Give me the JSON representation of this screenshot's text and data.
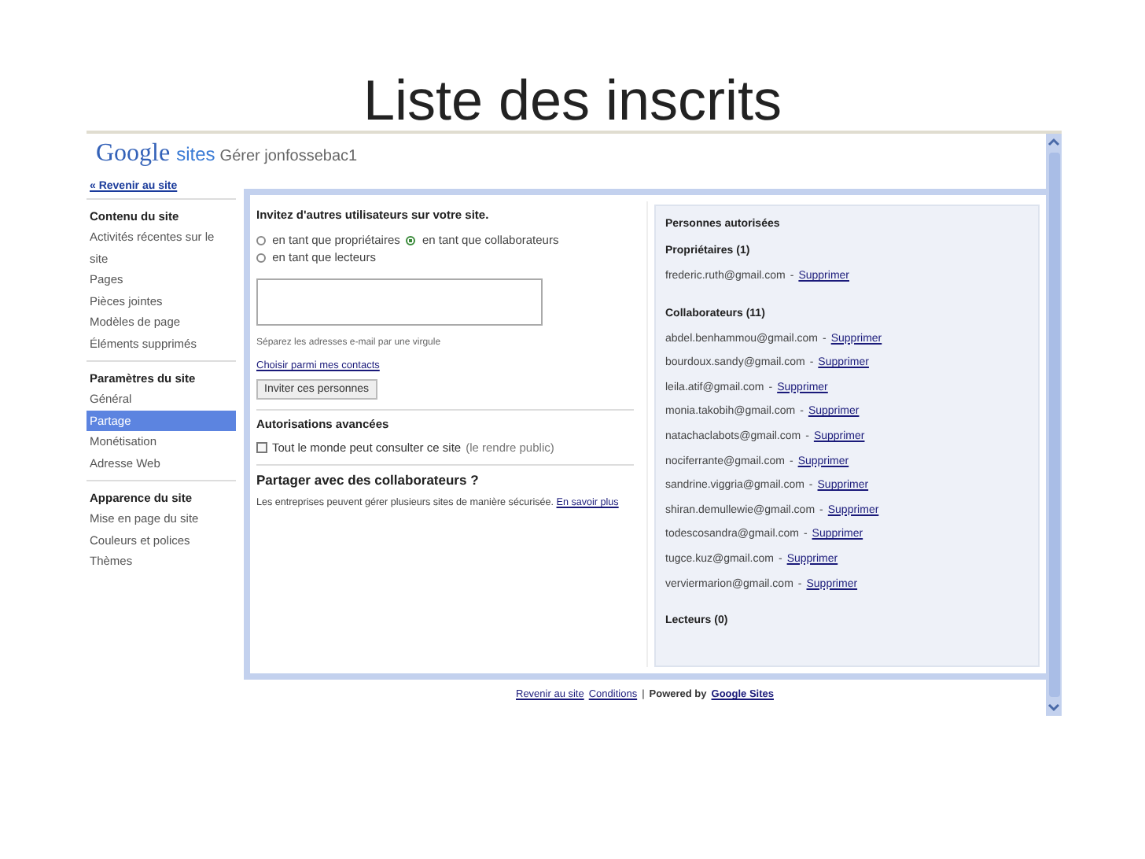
{
  "slide_title": "Liste des inscrits",
  "header": {
    "logo": "Google",
    "logo_suffix": "sites",
    "title": "Gérer jonfossebac1"
  },
  "sidebar": {
    "back_link": "« Revenir au site",
    "sections": [
      {
        "title": "Contenu du site",
        "items": [
          {
            "label": "Activités récentes sur le site",
            "selected": false
          },
          {
            "label": "Pages",
            "selected": false
          },
          {
            "label": "Pièces jointes",
            "selected": false
          },
          {
            "label": "Modèles de page",
            "selected": false
          },
          {
            "label": "Éléments supprimés",
            "selected": false
          }
        ]
      },
      {
        "title": "Paramètres du site",
        "items": [
          {
            "label": "Général",
            "selected": false
          },
          {
            "label": "Partage",
            "selected": true
          },
          {
            "label": "Monétisation",
            "selected": false
          },
          {
            "label": "Adresse Web",
            "selected": false
          }
        ]
      },
      {
        "title": "Apparence du site",
        "items": [
          {
            "label": "Mise en page du site",
            "selected": false
          },
          {
            "label": "Couleurs et polices",
            "selected": false
          },
          {
            "label": "Thèmes",
            "selected": false
          }
        ]
      }
    ]
  },
  "invite": {
    "heading": "Invitez d'autres utilisateurs sur votre site.",
    "roles": [
      {
        "label": "en tant que propriétaires",
        "selected": false
      },
      {
        "label": "en tant que collaborateurs",
        "selected": true
      },
      {
        "label": "en tant que lecteurs",
        "selected": false
      }
    ],
    "hint": "Séparez les adresses e-mail par une virgule",
    "contacts_link": "Choisir parmi mes contacts",
    "button": "Inviter ces personnes"
  },
  "advanced": {
    "heading": "Autorisations avancées",
    "public_label": "Tout le monde peut consulter ce site",
    "public_note": "(le rendre public)",
    "checked": false
  },
  "share": {
    "heading": "Partager avec des collaborateurs ?",
    "text": "Les entreprises peuvent gérer plusieurs sites de manière sécurisée.",
    "link": "En savoir plus"
  },
  "people": {
    "heading": "Personnes autorisées",
    "groups": [
      {
        "title": "Propriétaires (1)",
        "members": [
          {
            "email": "frederic.ruth@gmail.com",
            "action": "Supprimer"
          }
        ]
      },
      {
        "title": "Collaborateurs (11)",
        "members": [
          {
            "email": "abdel.benhammou@gmail.com",
            "action": "Supprimer"
          },
          {
            "email": "bourdoux.sandy@gmail.com",
            "action": "Supprimer"
          },
          {
            "email": "leila.atif@gmail.com",
            "action": "Supprimer"
          },
          {
            "email": "monia.takobih@gmail.com",
            "action": "Supprimer"
          },
          {
            "email": "natachaclabots@gmail.com",
            "action": "Supprimer"
          },
          {
            "email": "nociferrante@gmail.com",
            "action": "Supprimer"
          },
          {
            "email": "sandrine.viggria@gmail.com",
            "action": "Supprimer"
          },
          {
            "email": "shiran.demullewie@gmail.com",
            "action": "Supprimer"
          },
          {
            "email": "todescosandra@gmail.com",
            "action": "Supprimer"
          },
          {
            "email": "tugce.kuz@gmail.com",
            "action": "Supprimer"
          },
          {
            "email": "verviermarion@gmail.com",
            "action": "Supprimer"
          }
        ]
      },
      {
        "title": "Lecteurs (0)"
      }
    ],
    "separator": "-"
  },
  "footer": {
    "links": [
      "Revenir au site",
      "Conditions"
    ],
    "separator": "|",
    "powered": "Powered by",
    "brand_link": "Google Sites"
  }
}
